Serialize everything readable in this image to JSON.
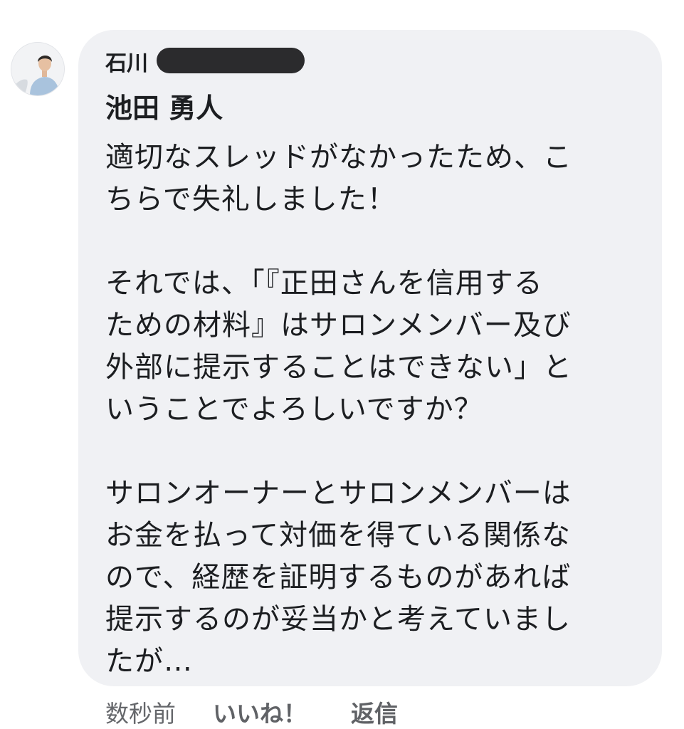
{
  "comment": {
    "group_name": "石川",
    "author": "池田 勇人",
    "lines": [
      "適切なスレッドがなかったため、こ",
      "ちらで失礼しました！",
      "",
      "それでは、「『正田さんを信用する",
      "ための材料』はサロンメンバー及び",
      "外部に提示することはできない」と",
      "いうことでよろしいですか？",
      "",
      "サロンオーナーとサロンメンバーは",
      "お金を払って対価を得ている関係な",
      "ので、経歴を証明するものがあれば",
      "提示するのが妥当かと考えていまし",
      "たが…"
    ],
    "timestamp": "数秒前",
    "like_label": "いいね！",
    "reply_label": "返信"
  },
  "colors": {
    "bubble": "#f0f1f4",
    "text": "#1c1e21",
    "meta": "#65676b",
    "redaction": "#2b2b2d"
  }
}
